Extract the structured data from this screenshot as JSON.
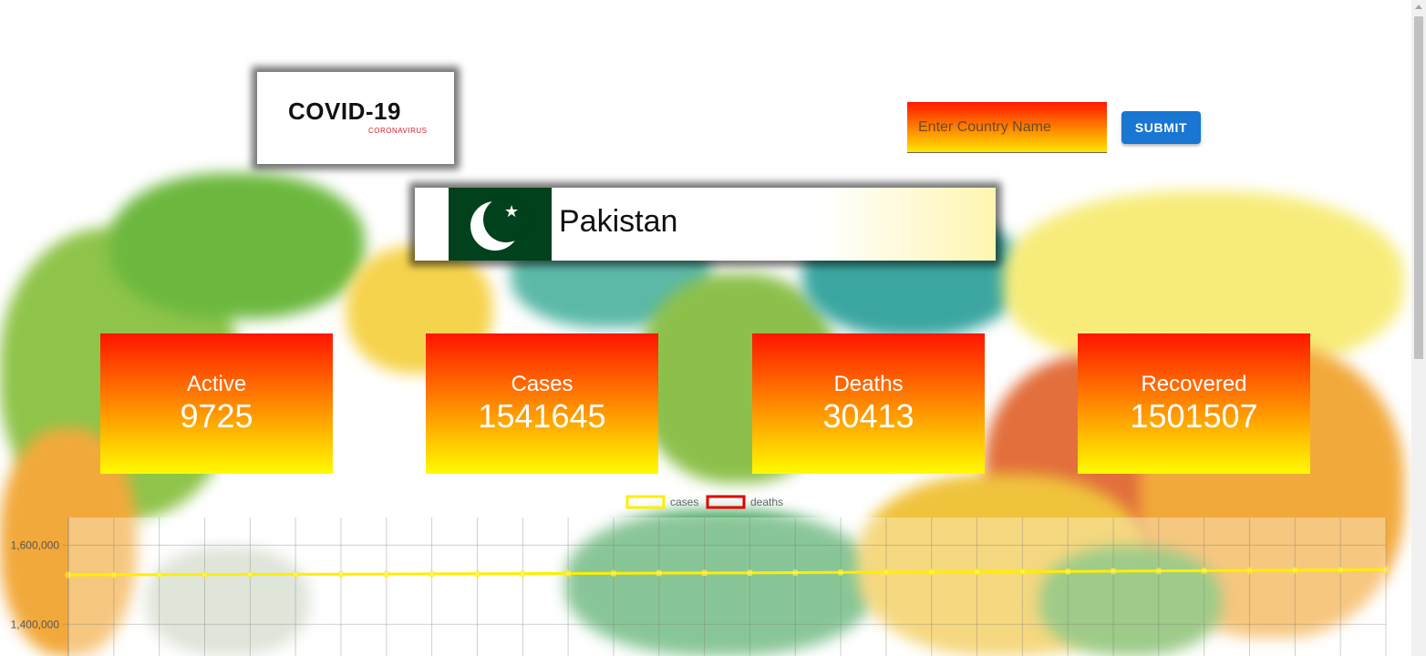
{
  "logo": {
    "title": "COVID-19",
    "subtitle": "CORONAVIRUS"
  },
  "search": {
    "placeholder": "Enter Country Name",
    "button_label": "SUBMIT"
  },
  "country": {
    "name": "Pakistan"
  },
  "stats": [
    {
      "label": "Active",
      "value": "9725"
    },
    {
      "label": "Cases",
      "value": "1541645"
    },
    {
      "label": "Deaths",
      "value": "30413"
    },
    {
      "label": "Recovered",
      "value": "1501507"
    }
  ],
  "colors": {
    "card_top": "#ff1500",
    "card_bottom": "#fffb00",
    "button": "#1976d2",
    "cases_line": "#ffee00",
    "deaths_line": "#e00000",
    "flag_green": "#01411c"
  },
  "chart_data": {
    "type": "line",
    "legend": [
      "cases",
      "deaths"
    ],
    "legend_position": "top-center",
    "yticks": [
      "1,600,000",
      "1,400,000"
    ],
    "ylim": [
      1320000,
      1670000
    ],
    "grid": true,
    "series": [
      {
        "name": "cases",
        "values": [
          1525000,
          1525200,
          1525400,
          1525700,
          1526000,
          1526300,
          1526600,
          1527000,
          1527400,
          1527800,
          1528200,
          1528600,
          1529000,
          1529400,
          1529800,
          1530200,
          1530700,
          1531200,
          1531700,
          1532200,
          1532700,
          1533200,
          1533700,
          1534300,
          1534900,
          1535500,
          1536100,
          1536800,
          1537500,
          1538200
        ]
      },
      {
        "name": "deaths",
        "values": []
      }
    ]
  }
}
